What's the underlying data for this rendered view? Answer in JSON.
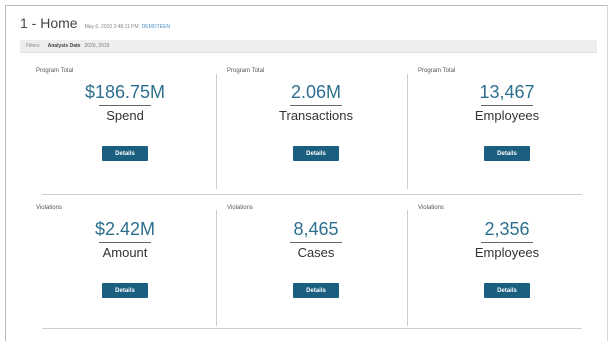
{
  "header": {
    "title": "1 - Home",
    "timestamp": "May 6, 2020 2:48:11 PM",
    "user": "DEMOTEEN"
  },
  "filters": {
    "label": "Filters",
    "name": "Analysis Date",
    "value": "2020, 2019"
  },
  "program_total": {
    "spend": {
      "label": "Program Total",
      "value": "$186.75M",
      "caption": "Spend",
      "button": "Details"
    },
    "transactions": {
      "label": "Program Total",
      "value": "2.06M",
      "caption": "Transactions",
      "button": "Details"
    },
    "employees": {
      "label": "Program Total",
      "value": "13,467",
      "caption": "Employees",
      "button": "Details"
    }
  },
  "violations": {
    "amount": {
      "label": "Violations",
      "value": "$2.42M",
      "caption": "Amount",
      "button": "Details"
    },
    "cases": {
      "label": "Violations",
      "value": "8,465",
      "caption": "Cases",
      "button": "Details"
    },
    "employees": {
      "label": "Violations",
      "value": "2,356",
      "caption": "Employees",
      "button": "Details"
    }
  }
}
